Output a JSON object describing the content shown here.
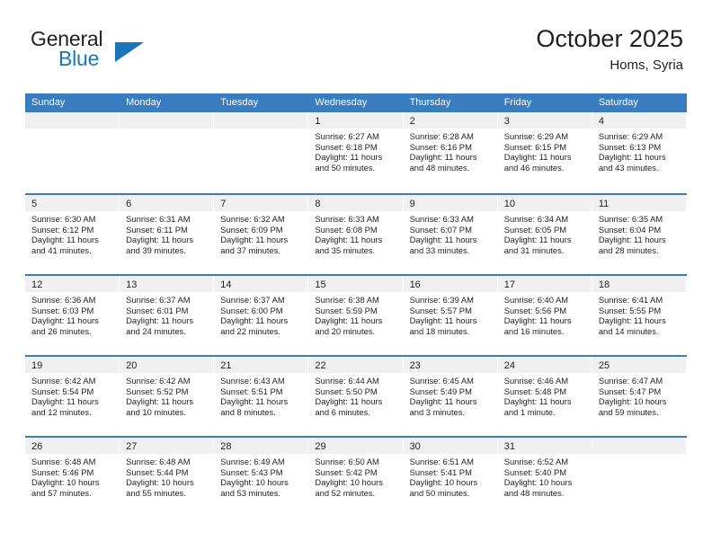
{
  "brand": {
    "name_line1": "General",
    "name_line2": "Blue",
    "color_dark": "#231f20",
    "color_blue": "#1b75bb"
  },
  "header": {
    "month_title": "October 2025",
    "location": "Homs, Syria"
  },
  "theme": {
    "header_blue": "#3a7cc0",
    "day_strip_gray": "#f0f0f0",
    "text": "#231f20"
  },
  "weekdays": [
    "Sunday",
    "Monday",
    "Tuesday",
    "Wednesday",
    "Thursday",
    "Friday",
    "Saturday"
  ],
  "weeks": [
    [
      {
        "day": "",
        "sunrise": "",
        "sunset": "",
        "daylight_line1": "",
        "daylight_line2": ""
      },
      {
        "day": "",
        "sunrise": "",
        "sunset": "",
        "daylight_line1": "",
        "daylight_line2": ""
      },
      {
        "day": "",
        "sunrise": "",
        "sunset": "",
        "daylight_line1": "",
        "daylight_line2": ""
      },
      {
        "day": "1",
        "sunrise": "Sunrise: 6:27 AM",
        "sunset": "Sunset: 6:18 PM",
        "daylight_line1": "Daylight: 11 hours",
        "daylight_line2": "and 50 minutes."
      },
      {
        "day": "2",
        "sunrise": "Sunrise: 6:28 AM",
        "sunset": "Sunset: 6:16 PM",
        "daylight_line1": "Daylight: 11 hours",
        "daylight_line2": "and 48 minutes."
      },
      {
        "day": "3",
        "sunrise": "Sunrise: 6:29 AM",
        "sunset": "Sunset: 6:15 PM",
        "daylight_line1": "Daylight: 11 hours",
        "daylight_line2": "and 46 minutes."
      },
      {
        "day": "4",
        "sunrise": "Sunrise: 6:29 AM",
        "sunset": "Sunset: 6:13 PM",
        "daylight_line1": "Daylight: 11 hours",
        "daylight_line2": "and 43 minutes."
      }
    ],
    [
      {
        "day": "5",
        "sunrise": "Sunrise: 6:30 AM",
        "sunset": "Sunset: 6:12 PM",
        "daylight_line1": "Daylight: 11 hours",
        "daylight_line2": "and 41 minutes."
      },
      {
        "day": "6",
        "sunrise": "Sunrise: 6:31 AM",
        "sunset": "Sunset: 6:11 PM",
        "daylight_line1": "Daylight: 11 hours",
        "daylight_line2": "and 39 minutes."
      },
      {
        "day": "7",
        "sunrise": "Sunrise: 6:32 AM",
        "sunset": "Sunset: 6:09 PM",
        "daylight_line1": "Daylight: 11 hours",
        "daylight_line2": "and 37 minutes."
      },
      {
        "day": "8",
        "sunrise": "Sunrise: 6:33 AM",
        "sunset": "Sunset: 6:08 PM",
        "daylight_line1": "Daylight: 11 hours",
        "daylight_line2": "and 35 minutes."
      },
      {
        "day": "9",
        "sunrise": "Sunrise: 6:33 AM",
        "sunset": "Sunset: 6:07 PM",
        "daylight_line1": "Daylight: 11 hours",
        "daylight_line2": "and 33 minutes."
      },
      {
        "day": "10",
        "sunrise": "Sunrise: 6:34 AM",
        "sunset": "Sunset: 6:05 PM",
        "daylight_line1": "Daylight: 11 hours",
        "daylight_line2": "and 31 minutes."
      },
      {
        "day": "11",
        "sunrise": "Sunrise: 6:35 AM",
        "sunset": "Sunset: 6:04 PM",
        "daylight_line1": "Daylight: 11 hours",
        "daylight_line2": "and 28 minutes."
      }
    ],
    [
      {
        "day": "12",
        "sunrise": "Sunrise: 6:36 AM",
        "sunset": "Sunset: 6:03 PM",
        "daylight_line1": "Daylight: 11 hours",
        "daylight_line2": "and 26 minutes."
      },
      {
        "day": "13",
        "sunrise": "Sunrise: 6:37 AM",
        "sunset": "Sunset: 6:01 PM",
        "daylight_line1": "Daylight: 11 hours",
        "daylight_line2": "and 24 minutes."
      },
      {
        "day": "14",
        "sunrise": "Sunrise: 6:37 AM",
        "sunset": "Sunset: 6:00 PM",
        "daylight_line1": "Daylight: 11 hours",
        "daylight_line2": "and 22 minutes."
      },
      {
        "day": "15",
        "sunrise": "Sunrise: 6:38 AM",
        "sunset": "Sunset: 5:59 PM",
        "daylight_line1": "Daylight: 11 hours",
        "daylight_line2": "and 20 minutes."
      },
      {
        "day": "16",
        "sunrise": "Sunrise: 6:39 AM",
        "sunset": "Sunset: 5:57 PM",
        "daylight_line1": "Daylight: 11 hours",
        "daylight_line2": "and 18 minutes."
      },
      {
        "day": "17",
        "sunrise": "Sunrise: 6:40 AM",
        "sunset": "Sunset: 5:56 PM",
        "daylight_line1": "Daylight: 11 hours",
        "daylight_line2": "and 16 minutes."
      },
      {
        "day": "18",
        "sunrise": "Sunrise: 6:41 AM",
        "sunset": "Sunset: 5:55 PM",
        "daylight_line1": "Daylight: 11 hours",
        "daylight_line2": "and 14 minutes."
      }
    ],
    [
      {
        "day": "19",
        "sunrise": "Sunrise: 6:42 AM",
        "sunset": "Sunset: 5:54 PM",
        "daylight_line1": "Daylight: 11 hours",
        "daylight_line2": "and 12 minutes."
      },
      {
        "day": "20",
        "sunrise": "Sunrise: 6:42 AM",
        "sunset": "Sunset: 5:52 PM",
        "daylight_line1": "Daylight: 11 hours",
        "daylight_line2": "and 10 minutes."
      },
      {
        "day": "21",
        "sunrise": "Sunrise: 6:43 AM",
        "sunset": "Sunset: 5:51 PM",
        "daylight_line1": "Daylight: 11 hours",
        "daylight_line2": "and 8 minutes."
      },
      {
        "day": "22",
        "sunrise": "Sunrise: 6:44 AM",
        "sunset": "Sunset: 5:50 PM",
        "daylight_line1": "Daylight: 11 hours",
        "daylight_line2": "and 6 minutes."
      },
      {
        "day": "23",
        "sunrise": "Sunrise: 6:45 AM",
        "sunset": "Sunset: 5:49 PM",
        "daylight_line1": "Daylight: 11 hours",
        "daylight_line2": "and 3 minutes."
      },
      {
        "day": "24",
        "sunrise": "Sunrise: 6:46 AM",
        "sunset": "Sunset: 5:48 PM",
        "daylight_line1": "Daylight: 11 hours",
        "daylight_line2": "and 1 minute."
      },
      {
        "day": "25",
        "sunrise": "Sunrise: 6:47 AM",
        "sunset": "Sunset: 5:47 PM",
        "daylight_line1": "Daylight: 10 hours",
        "daylight_line2": "and 59 minutes."
      }
    ],
    [
      {
        "day": "26",
        "sunrise": "Sunrise: 6:48 AM",
        "sunset": "Sunset: 5:46 PM",
        "daylight_line1": "Daylight: 10 hours",
        "daylight_line2": "and 57 minutes."
      },
      {
        "day": "27",
        "sunrise": "Sunrise: 6:48 AM",
        "sunset": "Sunset: 5:44 PM",
        "daylight_line1": "Daylight: 10 hours",
        "daylight_line2": "and 55 minutes."
      },
      {
        "day": "28",
        "sunrise": "Sunrise: 6:49 AM",
        "sunset": "Sunset: 5:43 PM",
        "daylight_line1": "Daylight: 10 hours",
        "daylight_line2": "and 53 minutes."
      },
      {
        "day": "29",
        "sunrise": "Sunrise: 6:50 AM",
        "sunset": "Sunset: 5:42 PM",
        "daylight_line1": "Daylight: 10 hours",
        "daylight_line2": "and 52 minutes."
      },
      {
        "day": "30",
        "sunrise": "Sunrise: 6:51 AM",
        "sunset": "Sunset: 5:41 PM",
        "daylight_line1": "Daylight: 10 hours",
        "daylight_line2": "and 50 minutes."
      },
      {
        "day": "31",
        "sunrise": "Sunrise: 6:52 AM",
        "sunset": "Sunset: 5:40 PM",
        "daylight_line1": "Daylight: 10 hours",
        "daylight_line2": "and 48 minutes."
      },
      {
        "day": "",
        "sunrise": "",
        "sunset": "",
        "daylight_line1": "",
        "daylight_line2": ""
      }
    ]
  ]
}
